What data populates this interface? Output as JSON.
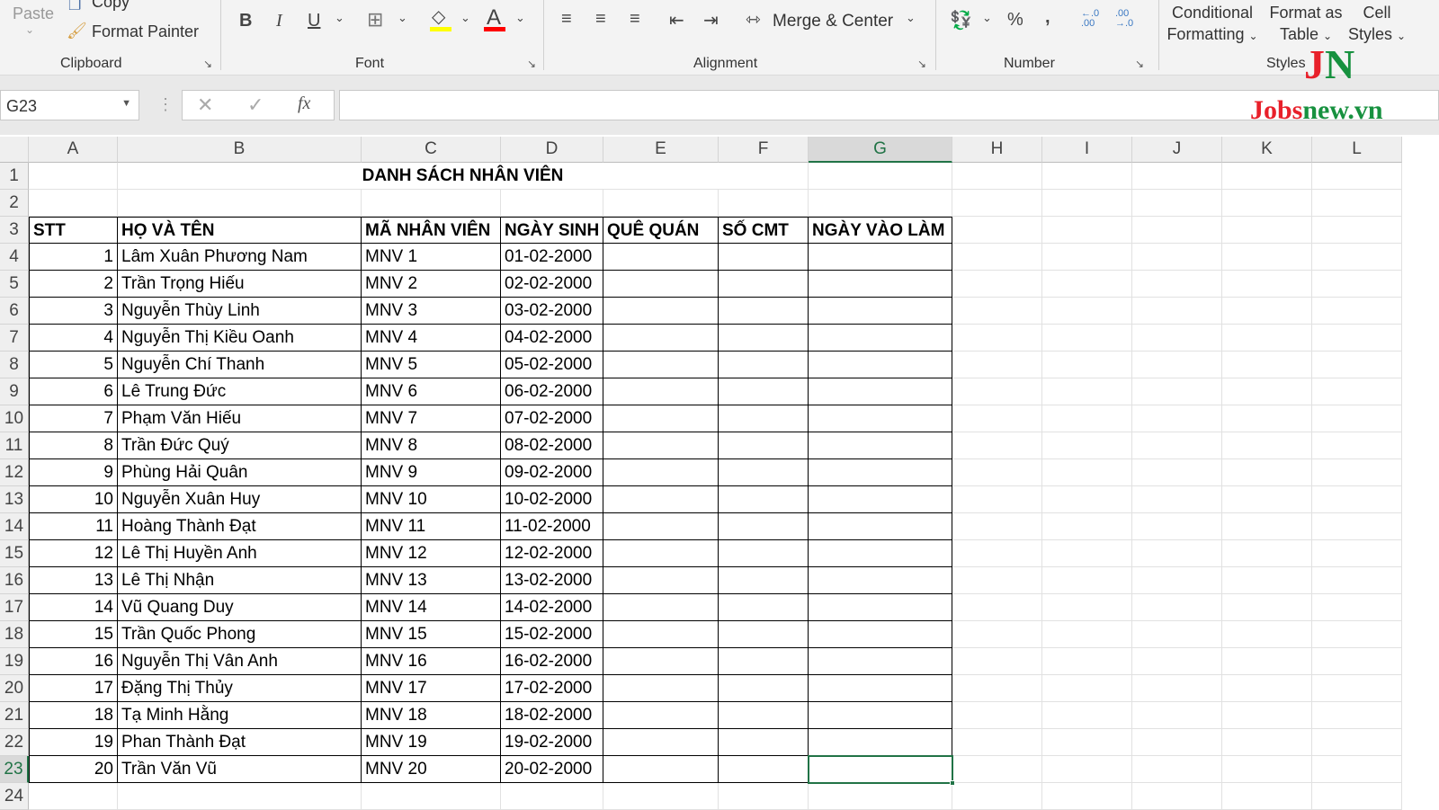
{
  "ribbon": {
    "clipboard": {
      "paste": "Paste",
      "copy": "Copy",
      "format_painter": "Format Painter",
      "label": "Clipboard"
    },
    "font": {
      "label": "Font",
      "bold": "B",
      "italic": "I",
      "underline": "U",
      "font_color_letter": "A",
      "fill_color": "#ffff00",
      "font_color": "#ff0000"
    },
    "alignment": {
      "label": "Alignment",
      "merge_center": "Merge & Center"
    },
    "number": {
      "label": "Number",
      "percent": "%",
      "comma": ",",
      "inc_decimal": "←.0 .00",
      "dec_decimal": ".00 →.0"
    },
    "styles": {
      "label": "Styles",
      "conditional_1": "Conditional",
      "conditional_2": "Formatting",
      "format_table_1": "Format as",
      "format_table_2": "Table",
      "cell_styles_1": "Cell",
      "cell_styles_2": "Styles"
    }
  },
  "watermark": {
    "logo": "JN",
    "text_red": "Jobs",
    "text_green": "new.vn"
  },
  "formula_bar": {
    "name_box": "G23",
    "fx": "fx",
    "formula": ""
  },
  "columns": [
    "A",
    "B",
    "C",
    "D",
    "E",
    "F",
    "G",
    "H",
    "I",
    "J",
    "K",
    "L"
  ],
  "selected_column": "G",
  "selected_row": 23,
  "sheet": {
    "title": "DANH SÁCH NHÂN VIÊN",
    "headers": [
      "STT",
      "HỌ VÀ TÊN",
      "MÃ NHÂN VIÊN",
      "NGÀY SINH",
      "QUÊ QUÁN",
      "SỐ CMT",
      "NGÀY VÀO LÀM"
    ],
    "rows": [
      [
        "1",
        "Lâm Xuân Phương Nam",
        "MNV 1",
        "01-02-2000"
      ],
      [
        "2",
        "Trần Trọng Hiếu",
        "MNV 2",
        "02-02-2000"
      ],
      [
        "3",
        "Nguyễn Thùy Linh",
        "MNV 3",
        "03-02-2000"
      ],
      [
        "4",
        "Nguyễn Thị Kiều Oanh",
        "MNV 4",
        "04-02-2000"
      ],
      [
        "5",
        "Nguyễn Chí Thanh",
        "MNV 5",
        "05-02-2000"
      ],
      [
        "6",
        "Lê Trung Đức",
        "MNV 6",
        "06-02-2000"
      ],
      [
        "7",
        "Phạm Văn Hiếu",
        "MNV 7",
        "07-02-2000"
      ],
      [
        "8",
        "Trần Đức Quý",
        "MNV 8",
        "08-02-2000"
      ],
      [
        "9",
        "Phùng Hải Quân",
        "MNV 9",
        "09-02-2000"
      ],
      [
        "10",
        "Nguyễn Xuân Huy",
        "MNV 10",
        "10-02-2000"
      ],
      [
        "11",
        "Hoàng Thành Đạt",
        "MNV 11",
        "11-02-2000"
      ],
      [
        "12",
        "Lê Thị Huyền Anh",
        "MNV 12",
        "12-02-2000"
      ],
      [
        "13",
        "Lê Thị Nhận",
        "MNV 13",
        "13-02-2000"
      ],
      [
        "14",
        "Vũ Quang Duy",
        "MNV 14",
        "14-02-2000"
      ],
      [
        "15",
        "Trần Quốc Phong",
        "MNV 15",
        "15-02-2000"
      ],
      [
        "16",
        "Nguyễn Thị Vân Anh",
        "MNV 16",
        "16-02-2000"
      ],
      [
        "17",
        "Đặng Thị Thủy",
        "MNV 17",
        "17-02-2000"
      ],
      [
        "18",
        "Tạ Minh Hằng",
        "MNV 18",
        "18-02-2000"
      ],
      [
        "19",
        "Phan Thành Đạt",
        "MNV 19",
        "19-02-2000"
      ],
      [
        "20",
        "Trần Văn Vũ",
        "MNV 20",
        "20-02-2000"
      ]
    ]
  }
}
